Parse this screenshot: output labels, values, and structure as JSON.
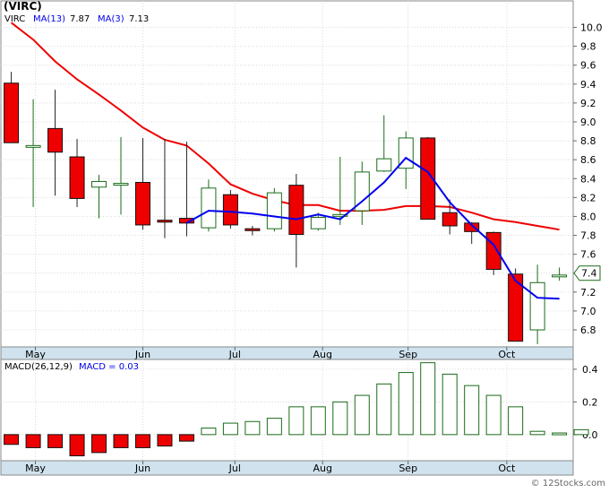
{
  "chart_data": [
    {
      "type": "candlestick",
      "ticker": "(VIRC)",
      "legend": {
        "symbol": "VIRC",
        "ma13_label": "MA(13)",
        "ma13_value": "7.87",
        "ma3_label": "MA(3)",
        "ma3_value": "7.13"
      },
      "y_ticks": [
        "10.0",
        "9.8",
        "9.6",
        "9.4",
        "9.2",
        "9.0",
        "8.8",
        "8.6",
        "8.4",
        "8.2",
        "8.0",
        "7.8",
        "7.6",
        "7.4",
        "7.2",
        "7.0",
        "6.8"
      ],
      "ylim": [
        6.62,
        10.28
      ],
      "x_months": [
        {
          "label": "May",
          "week": 1.1
        },
        {
          "label": "Jun",
          "week": 6.0
        },
        {
          "label": "Jul",
          "week": 10.2
        },
        {
          "label": "Aug",
          "week": 14.2
        },
        {
          "label": "Sep",
          "week": 18.1
        },
        {
          "label": "Oct",
          "week": 22.6
        }
      ],
      "last_price": "7.4",
      "colors": {
        "up": "#1a6b1a",
        "down": "#ee0000",
        "ma13": "#ee0000",
        "ma3": "#0000ee"
      },
      "candles": [
        {
          "o": 9.41,
          "h": 9.53,
          "l": 8.78,
          "c": 8.78
        },
        {
          "o": 8.75,
          "h": 9.24,
          "l": 8.1,
          "c": 8.75
        },
        {
          "o": 8.93,
          "h": 9.34,
          "l": 8.22,
          "c": 8.68
        },
        {
          "o": 8.63,
          "h": 8.82,
          "l": 8.1,
          "c": 8.19
        },
        {
          "o": 8.31,
          "h": 8.44,
          "l": 7.98,
          "c": 8.37
        },
        {
          "o": 8.35,
          "h": 8.84,
          "l": 8.02,
          "c": 8.35
        },
        {
          "o": 8.36,
          "h": 8.83,
          "l": 7.86,
          "c": 7.91
        },
        {
          "o": 7.96,
          "h": 8.82,
          "l": 7.77,
          "c": 7.94
        },
        {
          "o": 7.98,
          "h": 8.79,
          "l": 7.79,
          "c": 7.93
        },
        {
          "o": 7.88,
          "h": 8.39,
          "l": 7.84,
          "c": 8.3
        },
        {
          "o": 8.23,
          "h": 8.28,
          "l": 7.87,
          "c": 7.91
        },
        {
          "o": 7.87,
          "h": 7.9,
          "l": 7.8,
          "c": 7.85
        },
        {
          "o": 7.87,
          "h": 8.3,
          "l": 7.84,
          "c": 8.25
        },
        {
          "o": 8.33,
          "h": 8.45,
          "l": 7.46,
          "c": 7.81
        },
        {
          "o": 7.87,
          "h": 8.04,
          "l": 7.85,
          "c": 7.99
        },
        {
          "o": 8.01,
          "h": 8.63,
          "l": 7.91,
          "c": 8.02
        },
        {
          "o": 8.06,
          "h": 8.58,
          "l": 7.91,
          "c": 8.47
        },
        {
          "o": 8.48,
          "h": 9.07,
          "l": 8.47,
          "c": 8.61
        },
        {
          "o": 8.51,
          "h": 8.9,
          "l": 8.29,
          "c": 8.83
        },
        {
          "o": 8.83,
          "h": 8.84,
          "l": 7.97,
          "c": 7.97
        },
        {
          "o": 8.04,
          "h": 8.18,
          "l": 7.81,
          "c": 7.9
        },
        {
          "o": 7.93,
          "h": 7.94,
          "l": 7.71,
          "c": 7.84
        },
        {
          "o": 7.83,
          "h": 7.84,
          "l": 7.38,
          "c": 7.44
        },
        {
          "o": 7.39,
          "h": 7.45,
          "l": 6.68,
          "c": 6.68
        },
        {
          "o": 6.8,
          "h": 7.49,
          "l": 6.65,
          "c": 7.3
        },
        {
          "o": 7.38,
          "h": 7.46,
          "l": 7.32,
          "c": 7.38
        }
      ],
      "ma13": [
        10.05,
        9.87,
        9.64,
        9.45,
        9.29,
        9.12,
        8.94,
        8.81,
        8.75,
        8.56,
        8.34,
        8.24,
        8.17,
        8.12,
        8.12,
        8.06,
        8.06,
        8.07,
        8.11,
        8.11,
        8.1,
        8.04,
        7.97,
        7.94,
        7.9,
        7.86
      ],
      "ma3": [
        null,
        null,
        null,
        null,
        null,
        null,
        null,
        null,
        7.93,
        8.06,
        8.05,
        8.03,
        8.0,
        7.97,
        8.02,
        7.97,
        8.16,
        8.36,
        8.62,
        8.47,
        8.15,
        7.91,
        7.7,
        7.32,
        7.14,
        7.13
      ]
    },
    {
      "type": "bar",
      "legend": {
        "label": "MACD(26,12,9)",
        "value_label": "MACD = 0.03"
      },
      "y_ticks": [
        "0.4",
        "0.2",
        "0.0"
      ],
      "ylim": [
        -0.16,
        0.46
      ],
      "values": [
        -0.06,
        -0.08,
        -0.08,
        -0.13,
        -0.11,
        -0.08,
        -0.08,
        -0.07,
        -0.04,
        0.04,
        0.07,
        0.08,
        0.1,
        0.17,
        0.17,
        0.2,
        0.24,
        0.31,
        0.38,
        0.44,
        0.37,
        0.3,
        0.24,
        0.17,
        0.02,
        0.01,
        0.03
      ]
    }
  ],
  "footer": {
    "copyright": "© 12Stocks.com"
  }
}
